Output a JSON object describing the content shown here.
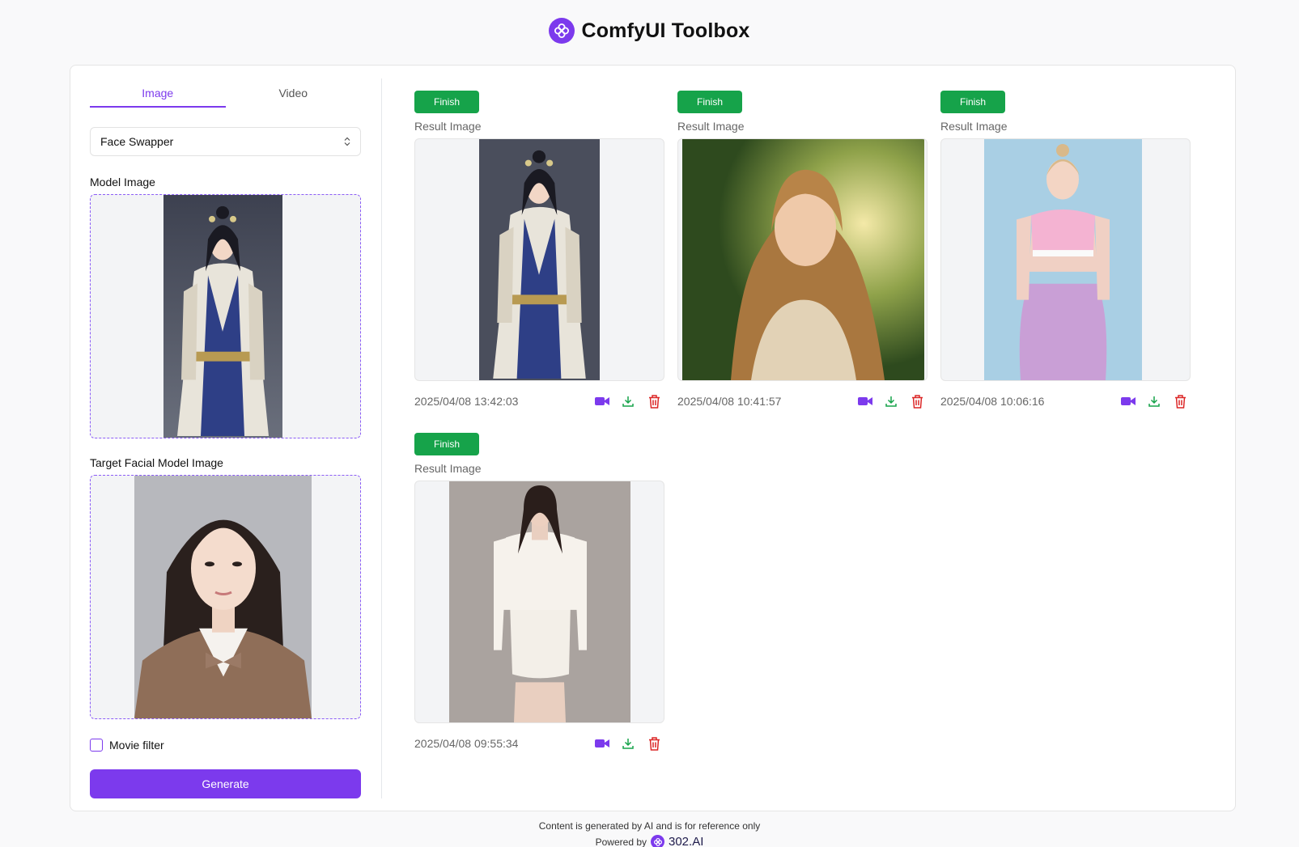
{
  "app": {
    "title": "ComfyUI Toolbox"
  },
  "tabs": [
    {
      "label": "Image",
      "active": true
    },
    {
      "label": "Video",
      "active": false
    }
  ],
  "tool_select": {
    "value": "Face Swapper"
  },
  "model_image": {
    "label": "Model Image"
  },
  "target_image": {
    "label": "Target Facial Model Image"
  },
  "movie_filter": {
    "label": "Movie filter",
    "checked": false
  },
  "generate": {
    "label": "Generate"
  },
  "results": [
    {
      "status": "Finish",
      "label": "Result Image",
      "timestamp": "2025/04/08 13:42:03"
    },
    {
      "status": "Finish",
      "label": "Result Image",
      "timestamp": "2025/04/08 10:41:57"
    },
    {
      "status": "Finish",
      "label": "Result Image",
      "timestamp": "2025/04/08 10:06:16"
    },
    {
      "status": "Finish",
      "label": "Result Image",
      "timestamp": "2025/04/08 09:55:34"
    }
  ],
  "footer": {
    "disclaimer": "Content is generated by AI and is for reference only",
    "powered_by": "Powered by",
    "brand": "302.AI"
  },
  "colors": {
    "accent": "#7c3aed",
    "finish": "#16a34a",
    "download": "#16a34a",
    "delete": "#dc2626"
  },
  "icons": {
    "logo": "clover-logo-icon",
    "video": "video-camera-icon",
    "download": "download-icon",
    "delete": "trash-icon",
    "select": "chevron-updown-icon"
  }
}
